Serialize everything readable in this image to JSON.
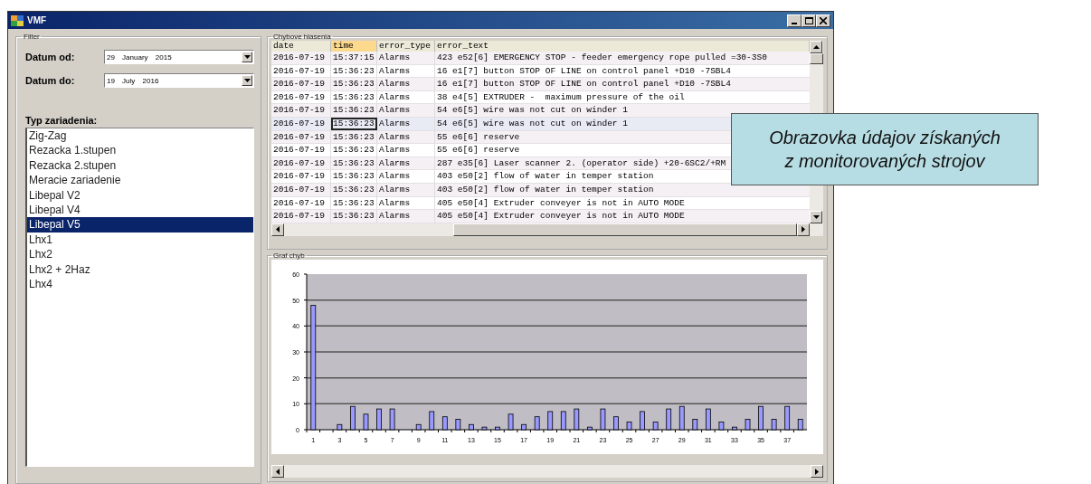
{
  "window": {
    "title": "VMF"
  },
  "filter": {
    "title": "Filter",
    "date_from": {
      "label": "Datum od:",
      "value": "29 January 2015"
    },
    "date_to": {
      "label": "Datum do:",
      "value": "19 July 2016"
    },
    "device_label": "Typ zariadenia:",
    "devices": [
      {
        "label": "Zig-Zag",
        "selected": false
      },
      {
        "label": "Rezacka 1.stupen",
        "selected": false
      },
      {
        "label": "Rezacka 2.stupen",
        "selected": false
      },
      {
        "label": "Meracie zariadenie",
        "selected": false
      },
      {
        "label": "Libepal V2",
        "selected": false
      },
      {
        "label": "Libepal V4",
        "selected": false
      },
      {
        "label": "Libepal V5",
        "selected": true
      },
      {
        "label": "Lhx1",
        "selected": false
      },
      {
        "label": "Lhx2",
        "selected": false
      },
      {
        "label": "Lhx2 + 2Haz",
        "selected": false
      },
      {
        "label": "Lhx4",
        "selected": false
      }
    ]
  },
  "messages": {
    "title": "Chybove hlasenia",
    "columns": [
      {
        "label": "date",
        "selected": false
      },
      {
        "label": "time",
        "selected": true
      },
      {
        "label": "error_type",
        "selected": false
      },
      {
        "label": "error_text",
        "selected": false
      }
    ],
    "rows": [
      {
        "cells": [
          "2016-07-19",
          "15:37:15",
          "Alarms",
          "423 e52[6] EMERGENCY STOP - feeder emergency rope pulled =30-3S0"
        ],
        "selected": false
      },
      {
        "cells": [
          "2016-07-19",
          "15:36:23",
          "Alarms",
          "16 e1[7] button STOP OF LINE on control panel +D10 -7SBL4"
        ],
        "selected": false
      },
      {
        "cells": [
          "2016-07-19",
          "15:36:23",
          "Alarms",
          "16 e1[7] button STOP OF LINE on control panel +D10 -7SBL4"
        ],
        "selected": false
      },
      {
        "cells": [
          "2016-07-19",
          "15:36:23",
          "Alarms",
          "38 e4[5] EXTRUDER -  maximum pressure of the oil"
        ],
        "selected": false
      },
      {
        "cells": [
          "2016-07-19",
          "15:36:23",
          "Alarms",
          "54 e6[5] wire was not cut on winder 1"
        ],
        "selected": false
      },
      {
        "cells": [
          "2016-07-19",
          "15:36:23",
          "Alarms",
          "54 e6[5] wire was not cut on winder 1"
        ],
        "selected": true
      },
      {
        "cells": [
          "2016-07-19",
          "15:36:23",
          "Alarms",
          "55 e6[6] reserve"
        ],
        "selected": false
      },
      {
        "cells": [
          "2016-07-19",
          "15:36:23",
          "Alarms",
          "55 e6[6] reserve"
        ],
        "selected": false
      },
      {
        "cells": [
          "2016-07-19",
          "15:36:23",
          "Alarms",
          "287 e35[6] Laser scanner 2. (operator side) +20-6SC2/+RM"
        ],
        "selected": false
      },
      {
        "cells": [
          "2016-07-19",
          "15:36:23",
          "Alarms",
          "403 e50[2] flow of water in temper station"
        ],
        "selected": false
      },
      {
        "cells": [
          "2016-07-19",
          "15:36:23",
          "Alarms",
          "403 e50[2] flow of water in temper station"
        ],
        "selected": false
      },
      {
        "cells": [
          "2016-07-19",
          "15:36:23",
          "Alarms",
          "405 e50[4] Extruder conveyer is not in AUTO MODE"
        ],
        "selected": false
      },
      {
        "cells": [
          "2016-07-19",
          "15:36:23",
          "Alarms",
          "405 e50[4] Extruder conveyer is not in AUTO MODE"
        ],
        "selected": false
      }
    ]
  },
  "chart_panel": {
    "title": "Graf chyb",
    "chart_data": {
      "type": "bar",
      "x": [
        1,
        2,
        3,
        4,
        5,
        6,
        7,
        8,
        9,
        10,
        11,
        12,
        13,
        14,
        15,
        16,
        17,
        18,
        19,
        20,
        21,
        22,
        23,
        24,
        25,
        26,
        27,
        28,
        29,
        30,
        31,
        32,
        33,
        34,
        35,
        36,
        37,
        38
      ],
      "series": [
        {
          "color": "#9999ff",
          "values": [
            48,
            0,
            2,
            9,
            6,
            8,
            8,
            0,
            2,
            7,
            5,
            4,
            2,
            1,
            1,
            6,
            2,
            5,
            7,
            7,
            8,
            1,
            8,
            5,
            3,
            7,
            3,
            8,
            9,
            4,
            8,
            3,
            1,
            4,
            9,
            4,
            9,
            4
          ]
        }
      ],
      "xlim": [
        0.5,
        38.5
      ],
      "grid": true,
      "ylim": [
        0,
        60
      ],
      "yticks": [
        0,
        10,
        20,
        30,
        40,
        50,
        60
      ],
      "xticks": [
        1,
        3,
        5,
        7,
        9,
        11,
        13,
        15,
        17,
        19,
        21,
        23,
        25,
        27,
        29,
        31,
        33,
        35,
        37
      ]
    }
  },
  "callout": {
    "text": "Obrazovka údajov získaných\nz monitorovaných strojov"
  }
}
